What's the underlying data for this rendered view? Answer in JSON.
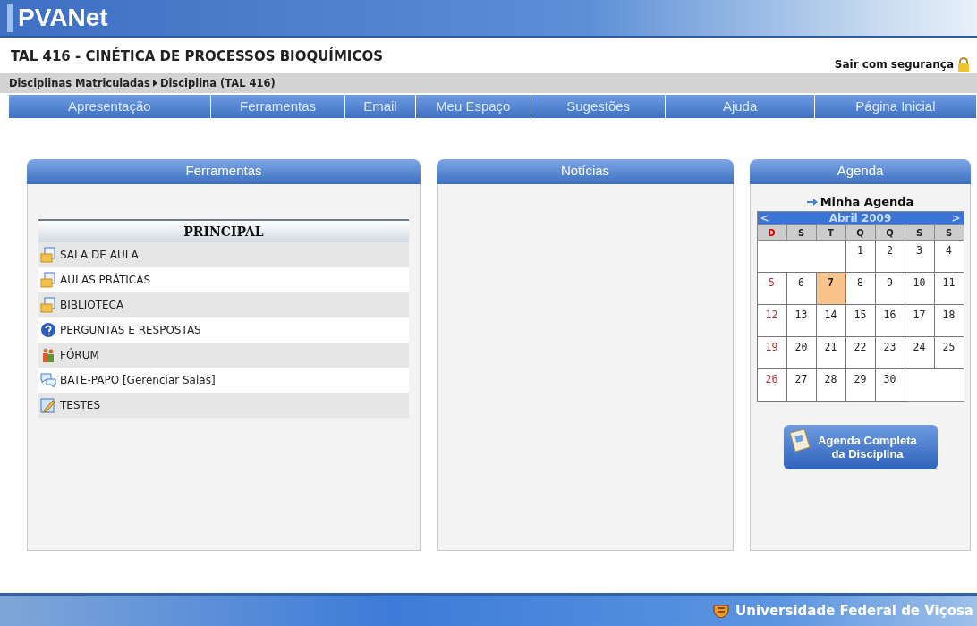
{
  "header": {
    "logo": "PVANet"
  },
  "course": {
    "title": "TAL 416 - CINÉTICA DE PROCESSOS BIOQUÍMICOS",
    "logout": "Sair com segurança"
  },
  "breadcrumb": [
    "Disciplinas Matriculadas",
    "Disciplina (TAL 416)"
  ],
  "nav": [
    "Apresentação",
    "Ferramentas",
    "Email",
    "Meu Espaço",
    "Sugestões",
    "Ajuda",
    "Página Inicial"
  ],
  "tools": {
    "title": "Ferramentas",
    "section": "PRINCIPAL",
    "items": [
      {
        "kind": "folder",
        "label": "SALA DE AULA"
      },
      {
        "kind": "folder",
        "label": "AULAS PRÁTICAS"
      },
      {
        "kind": "folder",
        "label": "BIBLIOTECA"
      },
      {
        "kind": "help",
        "label": "PERGUNTAS E RESPOSTAS"
      },
      {
        "kind": "people",
        "label": "FÓRUM"
      },
      {
        "kind": "chat",
        "label": "BATE-PAPO [Gerenciar Salas]"
      },
      {
        "kind": "test",
        "label": "TESTES"
      }
    ]
  },
  "news": {
    "title": "Notícias"
  },
  "agenda": {
    "title": "Agenda",
    "link": "Minha Agenda",
    "calendar": {
      "prev": "<",
      "month": "Abril  2009",
      "next": ">",
      "weekdays": [
        "D",
        "S",
        "T",
        "Q",
        "Q",
        "S",
        "S"
      ],
      "weeks": [
        [
          {
            "day": "1",
            "selected": false
          },
          {
            "day": "2",
            "selected": false
          },
          {
            "day": "3",
            "selected": false
          },
          {
            "day": "4",
            "selected": false
          }
        ],
        [
          {
            "day": "5",
            "selected": false
          },
          {
            "day": "6",
            "selected": false
          },
          {
            "day": "7",
            "selected": true
          },
          {
            "day": "8",
            "selected": false
          },
          {
            "day": "9",
            "selected": false
          },
          {
            "day": "10",
            "selected": false
          },
          {
            "day": "11",
            "selected": false
          }
        ],
        [
          {
            "day": "12",
            "selected": false
          },
          {
            "day": "13",
            "selected": false
          },
          {
            "day": "14",
            "selected": false
          },
          {
            "day": "15",
            "selected": false
          },
          {
            "day": "16",
            "selected": false
          },
          {
            "day": "17",
            "selected": false
          },
          {
            "day": "18",
            "selected": false
          }
        ],
        [
          {
            "day": "19",
            "selected": false
          },
          {
            "day": "20",
            "selected": false
          },
          {
            "day": "21",
            "selected": false
          },
          {
            "day": "22",
            "selected": false
          },
          {
            "day": "23",
            "selected": false
          },
          {
            "day": "24",
            "selected": false
          },
          {
            "day": "25",
            "selected": false
          }
        ],
        [
          {
            "day": "26",
            "selected": false
          },
          {
            "day": "27",
            "selected": false
          },
          {
            "day": "28",
            "selected": false
          },
          {
            "day": "29",
            "selected": false
          },
          {
            "day": "30",
            "selected": false
          }
        ]
      ]
    },
    "button": "Agenda Completa da Disciplina"
  },
  "footer": {
    "university": "Universidade Federal de Viçosa"
  }
}
